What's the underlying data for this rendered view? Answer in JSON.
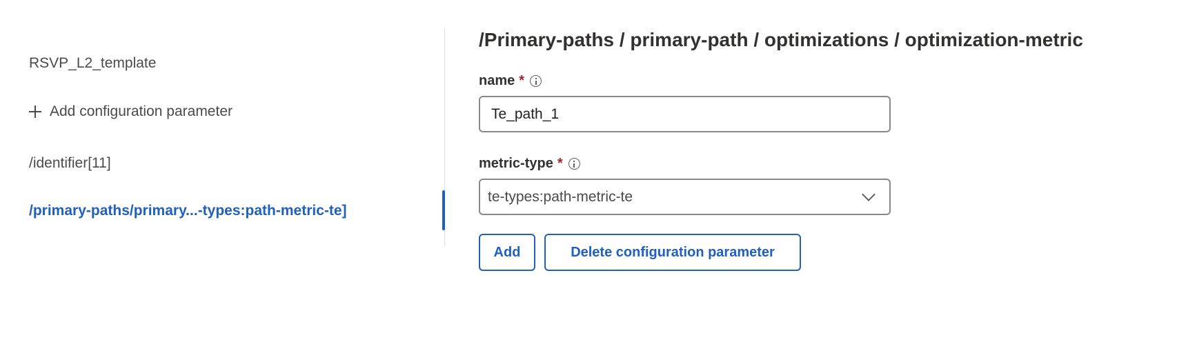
{
  "sidebar": {
    "template_name": "RSVP_L2_template",
    "add_param_label": "Add configuration parameter",
    "identifier_label": "/identifier[11]",
    "active_item_label": "/primary-paths/primary...-types:path-metric-te]"
  },
  "main": {
    "title": "/Primary-paths / primary-path / optimizations / optimization-metric",
    "name_field": {
      "label": "name",
      "required": "*",
      "value": "Te_path_1"
    },
    "metric_type_field": {
      "label": "metric-type",
      "required": "*",
      "value": "te-types:path-metric-te"
    },
    "buttons": {
      "add_label": "Add",
      "delete_label": "Delete configuration parameter"
    }
  },
  "colors": {
    "accent": "#1f5fbf",
    "required": "#a4262c",
    "border": "#8a8886"
  }
}
